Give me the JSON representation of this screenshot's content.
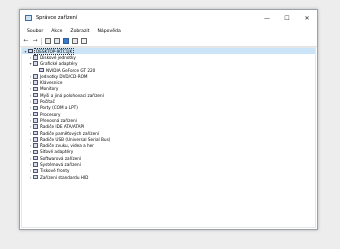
{
  "window": {
    "title": "Správce zařízení",
    "minimize": "—",
    "maximize": "☐",
    "close": "✕"
  },
  "menu": [
    "Soubor",
    "Akce",
    "Zobrazit",
    "Nápověda"
  ],
  "tree": {
    "root": "DESKTOP-IKTC1JK",
    "items": [
      {
        "label": "Diskové jednotky",
        "level": 1,
        "state": "collapsed",
        "icon": "disk-icon"
      },
      {
        "label": "Grafické adaptéry",
        "level": 1,
        "state": "expanded",
        "icon": "display-adapter-icon"
      },
      {
        "label": "NVIDIA GeForce GT 220",
        "level": 2,
        "state": "none",
        "icon": "display-adapter-icon"
      },
      {
        "label": "Jednotky DVD/CD-ROM",
        "level": 1,
        "state": "collapsed",
        "icon": "dvd-icon"
      },
      {
        "label": "Klávesnice",
        "level": 1,
        "state": "collapsed",
        "icon": "keyboard-icon"
      },
      {
        "label": "Monitory",
        "level": 1,
        "state": "collapsed",
        "icon": "monitor-icon"
      },
      {
        "label": "Myši a jiná polohovací zařízení",
        "level": 1,
        "state": "collapsed",
        "icon": "mouse-icon"
      },
      {
        "label": "Počítač",
        "level": 1,
        "state": "collapsed",
        "icon": "computer-icon"
      },
      {
        "label": "Porty (COM a LPT)",
        "level": 1,
        "state": "collapsed",
        "icon": "port-icon"
      },
      {
        "label": "Procesory",
        "level": 1,
        "state": "collapsed",
        "icon": "processor-icon"
      },
      {
        "label": "Přenosná zařízení",
        "level": 1,
        "state": "collapsed",
        "icon": "portable-device-icon"
      },
      {
        "label": "Řadiče IDE ATA/ATAPI",
        "level": 1,
        "state": "collapsed",
        "icon": "controller-icon"
      },
      {
        "label": "Řadiče paměťových zařízení",
        "level": 1,
        "state": "collapsed",
        "icon": "controller-icon"
      },
      {
        "label": "Řadiče USB (Universal Serial Bus)",
        "level": 1,
        "state": "collapsed",
        "icon": "usb-icon"
      },
      {
        "label": "Řadiče zvuku, videa a her",
        "level": 1,
        "state": "collapsed",
        "icon": "sound-icon"
      },
      {
        "label": "Síťové adaptéry",
        "level": 1,
        "state": "collapsed",
        "icon": "network-icon"
      },
      {
        "label": "Softwarová zařízení",
        "level": 1,
        "state": "collapsed",
        "icon": "software-device-icon"
      },
      {
        "label": "Systémová zařízení",
        "level": 1,
        "state": "collapsed",
        "icon": "system-device-icon"
      },
      {
        "label": "Tiskové fronty",
        "level": 1,
        "state": "collapsed",
        "icon": "printer-icon"
      },
      {
        "label": "Zařízení standardu HID",
        "level": 1,
        "state": "collapsed",
        "icon": "hid-icon"
      }
    ]
  }
}
